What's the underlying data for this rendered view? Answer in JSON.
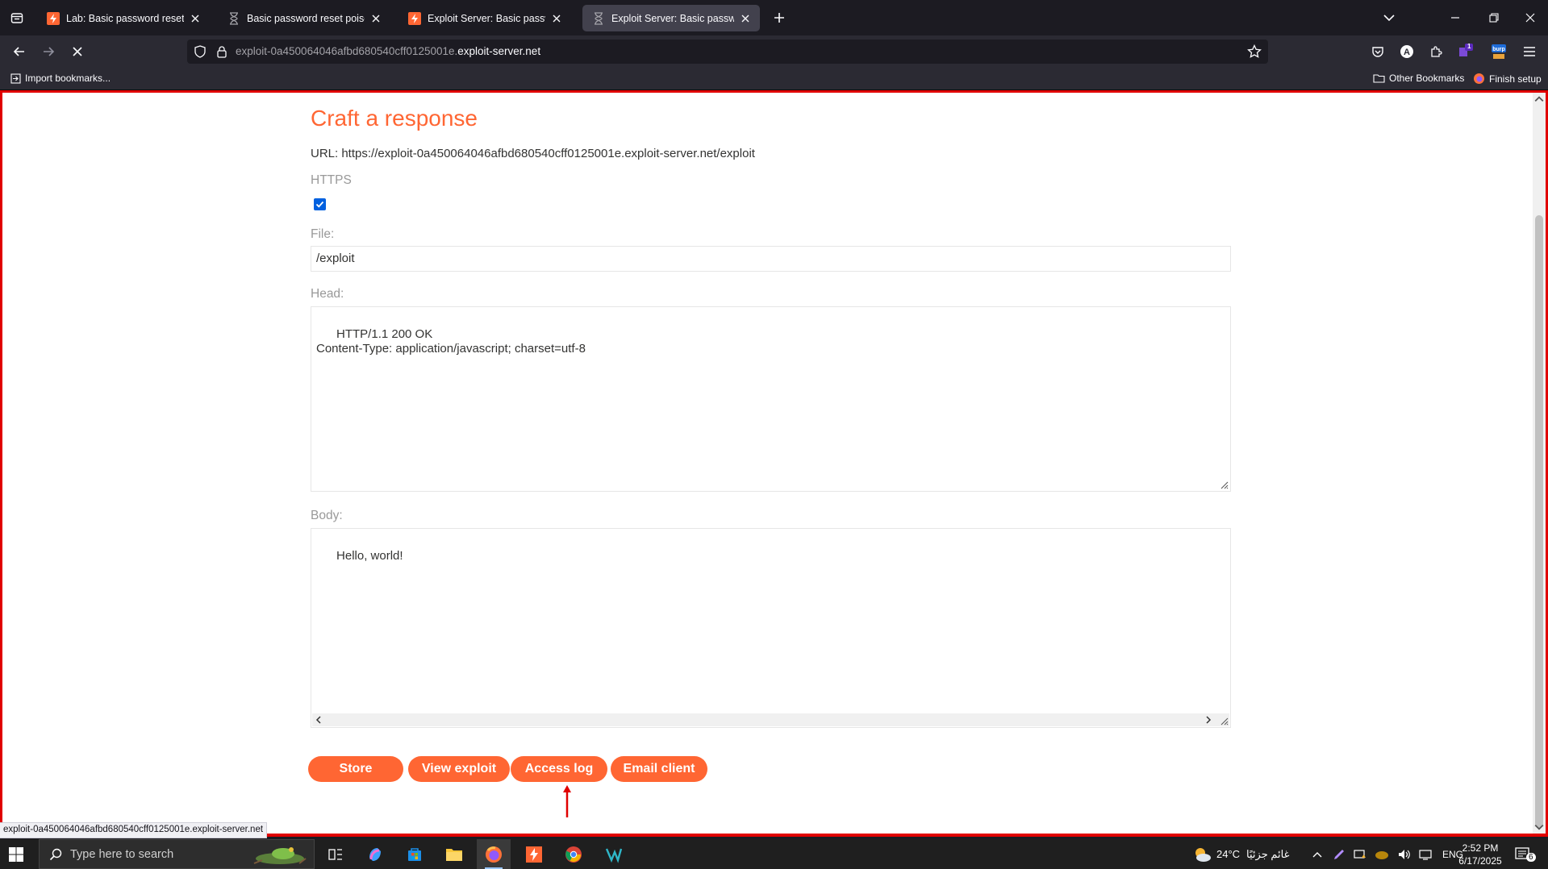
{
  "browser": {
    "tabs": [
      {
        "title": "Lab: Basic password reset poisoning",
        "favicon": "portswigger-icon",
        "active": false
      },
      {
        "title": "Basic password reset poisoning",
        "favicon": "hourglass-icon",
        "active": false
      },
      {
        "title": "Exploit Server: Basic password reset poisoning",
        "favicon": "portswigger-icon",
        "active": false
      },
      {
        "title": "Exploit Server: Basic password reset poisoning",
        "favicon": "hourglass-icon",
        "active": true
      }
    ],
    "url_host_prefix": "exploit-0a450064046afbd680540cff0125001e.",
    "url_host_domain": "exploit-server.net",
    "bookmarks": {
      "import": "Import bookmarks...",
      "other": "Other Bookmarks",
      "finish": "Finish setup"
    },
    "extension_badge": "1",
    "status_link": "exploit-0a450064046afbd680540cff0125001e.exploit-server.net"
  },
  "page": {
    "heading": "Craft a response",
    "url_line": "URL: https://exploit-0a450064046afbd680540cff0125001e.exploit-server.net/exploit",
    "https_label": "HTTPS",
    "https_checked": true,
    "file_label": "File:",
    "file_value": "/exploit",
    "head_label": "Head:",
    "head_value": "HTTP/1.1 200 OK\nContent-Type: application/javascript; charset=utf-8",
    "body_label": "Body:",
    "body_value": "Hello, world!",
    "buttons": {
      "store": "Store",
      "view_exploit": "View exploit",
      "access_log": "Access log",
      "email_client": "Email client"
    },
    "accent_color": "#ff6633",
    "annotation_color": "#e00000"
  },
  "taskbar": {
    "search_placeholder": "Type here to search",
    "weather_temp": "24°C",
    "weather_text": "غائم جزئيًا",
    "language": "ENG",
    "time": "2:52 PM",
    "date": "6/17/2025",
    "notification_count": "6"
  }
}
